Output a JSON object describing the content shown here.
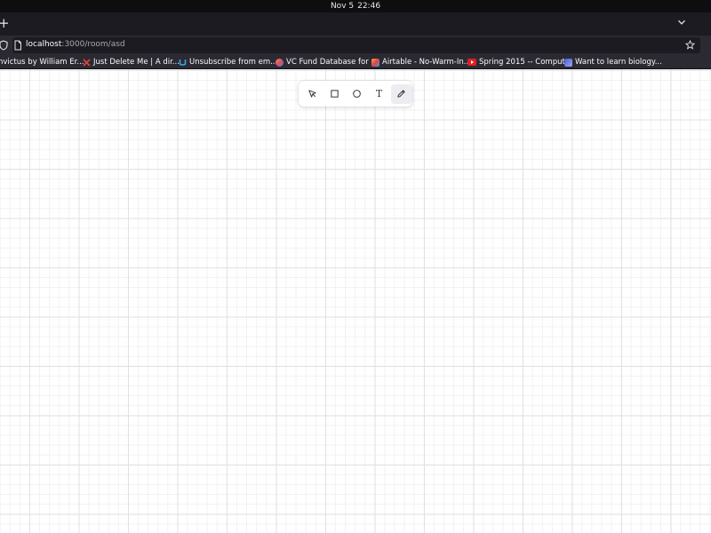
{
  "system": {
    "date": "Nov 5",
    "time": "22:46"
  },
  "browser": {
    "new_tab_symbol": "+",
    "url_host": "localhost",
    "url_path": ":3000/room/asd"
  },
  "bookmarks": [
    {
      "label": "nvictus by William Er...",
      "color": ""
    },
    {
      "label": "Just Delete Me | A dir...",
      "color": "#e0443a"
    },
    {
      "label": "Unsubscribe from em...",
      "color": "#3aa6e0"
    },
    {
      "label": "VC Fund Database for ...",
      "color": "#f0a030"
    },
    {
      "label": "Airtable - No-Warm-In...",
      "color": "#f0b030"
    },
    {
      "label": "Spring 2015 -- Comput...",
      "color": "#e02020"
    },
    {
      "label": "Want to learn biology...",
      "color": "#6a7ae0"
    }
  ],
  "toolbar": {
    "tools": [
      {
        "id": "select",
        "icon": "cursor-icon",
        "active": false
      },
      {
        "id": "rectangle",
        "icon": "square-icon",
        "active": false
      },
      {
        "id": "circle",
        "icon": "circle-icon",
        "active": false
      },
      {
        "id": "text",
        "icon": "text-icon",
        "label": "T",
        "active": false
      },
      {
        "id": "pencil",
        "icon": "pencil-icon",
        "active": true
      }
    ]
  }
}
